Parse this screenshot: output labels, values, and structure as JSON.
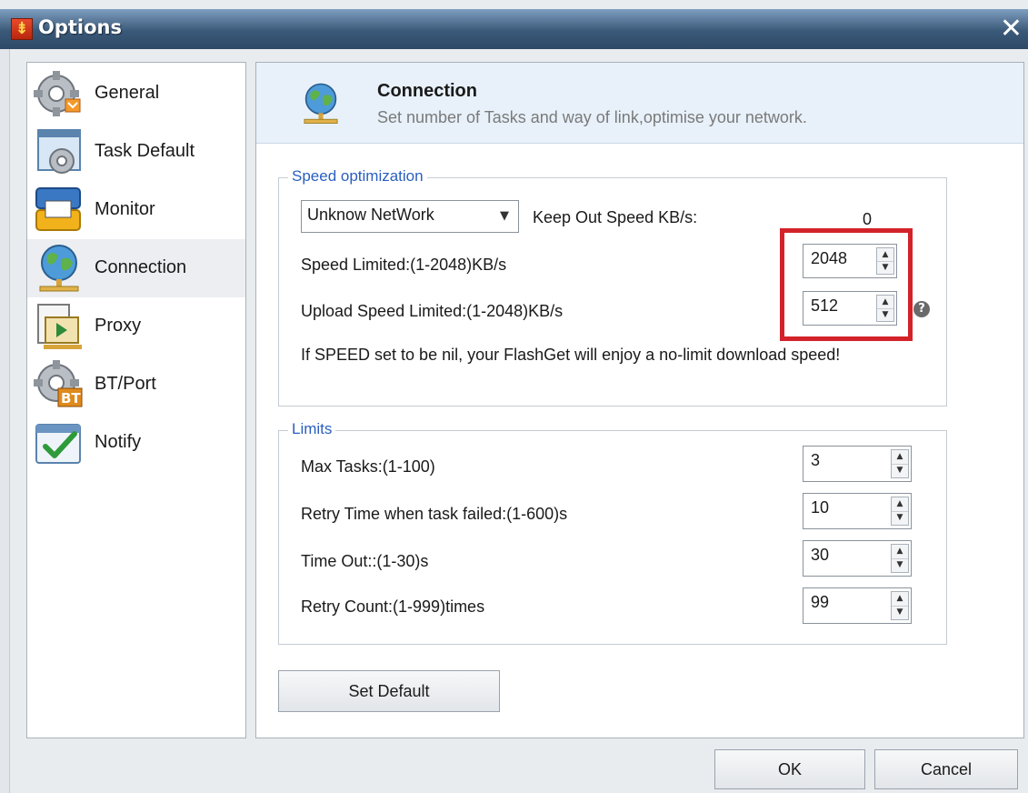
{
  "window": {
    "title": "Options",
    "app_icon_glyph": "⇟"
  },
  "sidebar": {
    "items": [
      {
        "label": "General",
        "icon": "gear-icon"
      },
      {
        "label": "Task Default",
        "icon": "gear-icon"
      },
      {
        "label": "Monitor",
        "icon": "monitor-icon"
      },
      {
        "label": "Connection",
        "icon": "globe-network-icon",
        "selected": true
      },
      {
        "label": "Proxy",
        "icon": "proxy-icon"
      },
      {
        "label": "BT/Port",
        "icon": "gear-bt-icon"
      },
      {
        "label": "Notify",
        "icon": "checkmark-icon"
      }
    ]
  },
  "header": {
    "title": "Connection",
    "subtitle": "Set  number of Tasks and way of link,optimise your network.",
    "icon": "globe-network-icon"
  },
  "speed": {
    "legend": "Speed optimization",
    "network_select": {
      "value": "Unknow NetWork"
    },
    "keep_out_label": "Keep Out Speed KB/s:",
    "keep_out_value": "0",
    "speed_limited_label": "Speed Limited:(1-2048)KB/s",
    "speed_limited_value": "2048",
    "upload_limited_label": "Upload Speed Limited:(1-2048)KB/s",
    "upload_limited_value": "512",
    "help_glyph": "?",
    "note": "If SPEED set to be nil, your FlashGet will enjoy a no-limit download speed!"
  },
  "limits": {
    "legend": "Limits",
    "max_tasks_label": "Max Tasks:(1-100)",
    "max_tasks_value": "3",
    "retry_time_label": "Retry Time when task failed:(1-600)s",
    "retry_time_value": "10",
    "timeout_label": "Time Out::(1-30)s",
    "timeout_value": "30",
    "retry_count_label": "Retry Count:(1-999)times",
    "retry_count_value": "99"
  },
  "buttons": {
    "set_default": "Set Default",
    "ok": "OK",
    "cancel": "Cancel"
  },
  "colors": {
    "highlight": "#d3222a",
    "legend": "#2a5fbf",
    "header_band": "#e8f1fa"
  }
}
